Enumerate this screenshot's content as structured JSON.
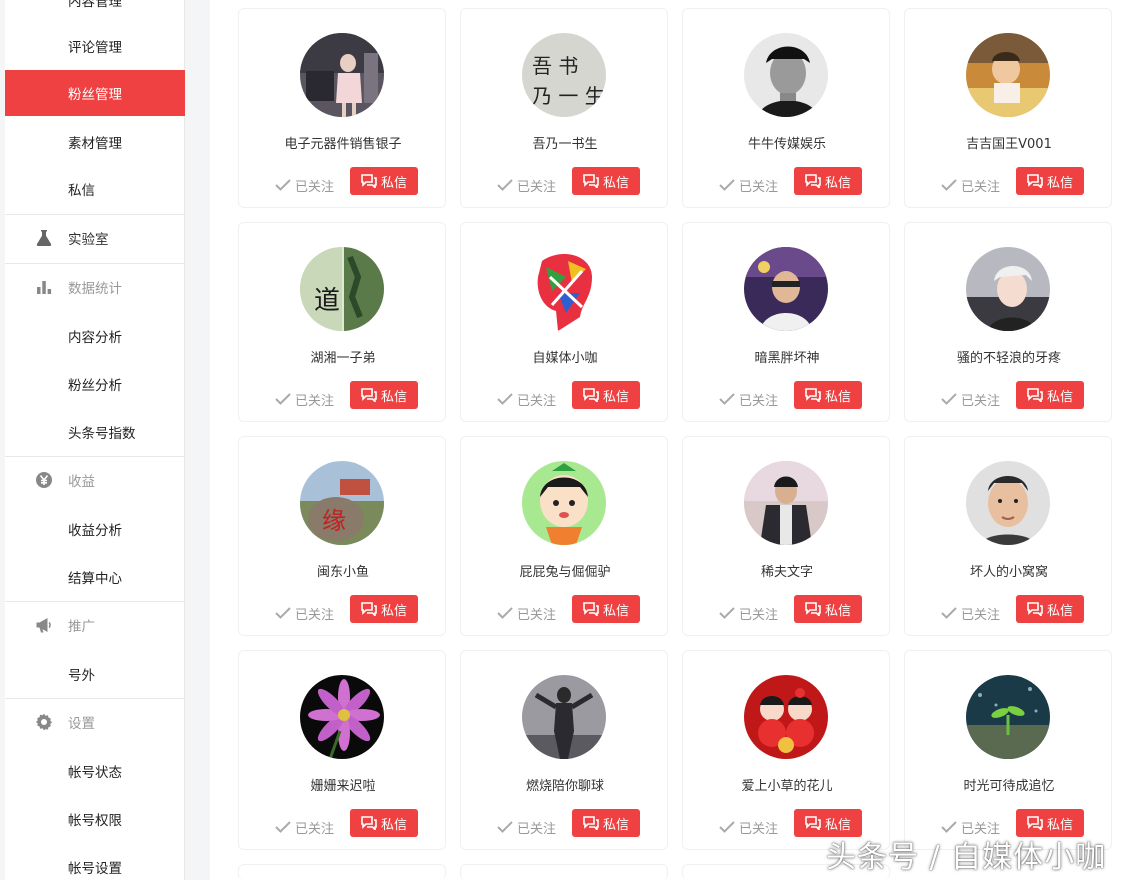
{
  "sidebar": {
    "cut_top_label": "内容管理",
    "items": [
      {
        "label": "评论管理"
      },
      {
        "label": "粉丝管理"
      },
      {
        "label": "素材管理"
      },
      {
        "label": "私信"
      },
      {
        "label": "实验室"
      },
      {
        "label": "数据统计"
      },
      {
        "label": "内容分析"
      },
      {
        "label": "粉丝分析"
      },
      {
        "label": "头条号指数"
      },
      {
        "label": "收益"
      },
      {
        "label": "收益分析"
      },
      {
        "label": "结算中心"
      },
      {
        "label": "推广"
      },
      {
        "label": "号外"
      },
      {
        "label": "设置"
      },
      {
        "label": "帐号状态"
      },
      {
        "label": "帐号权限"
      },
      {
        "label": "帐号设置"
      }
    ]
  },
  "cards": [
    {
      "name": "电子元器件销售银子",
      "follow": "已关注",
      "message": "私信"
    },
    {
      "name": "吾乃一书生",
      "follow": "已关注",
      "message": "私信"
    },
    {
      "name": "牛牛传媒娱乐",
      "follow": "已关注",
      "message": "私信"
    },
    {
      "name": "吉吉国王V001",
      "follow": "已关注",
      "message": "私信"
    },
    {
      "name": "湖湘一子弟",
      "follow": "已关注",
      "message": "私信"
    },
    {
      "name": "自媒体小咖",
      "follow": "已关注",
      "message": "私信"
    },
    {
      "name": "暗黑胖坏神",
      "follow": "已关注",
      "message": "私信"
    },
    {
      "name": "骚的不轻浪的牙疼",
      "follow": "已关注",
      "message": "私信"
    },
    {
      "name": "闽东小鱼",
      "follow": "已关注",
      "message": "私信"
    },
    {
      "name": "屁屁兔与倔倔驴",
      "follow": "已关注",
      "message": "私信"
    },
    {
      "name": "稀夫文字",
      "follow": "已关注",
      "message": "私信"
    },
    {
      "name": "坏人的小窝窝",
      "follow": "已关注",
      "message": "私信"
    },
    {
      "name": "姗姗来迟啦",
      "follow": "已关注",
      "message": "私信"
    },
    {
      "name": "燃烧陪你聊球",
      "follow": "已关注",
      "message": "私信"
    },
    {
      "name": "爱上小草的花儿",
      "follow": "已关注",
      "message": "私信"
    },
    {
      "name": "时光可待成追忆",
      "follow": "已关注",
      "message": "私信"
    }
  ],
  "avatar_texts": {
    "calligraphy_1": "吾 书",
    "calligraphy_2": "乃 一 生",
    "dao": "道",
    "yuan": "缘"
  },
  "watermark": "头条号 / 自媒体小咖",
  "colors": {
    "accent": "#f04142",
    "sidebar_bg": "#ffffff",
    "page_bg": "#f4f5f6"
  }
}
